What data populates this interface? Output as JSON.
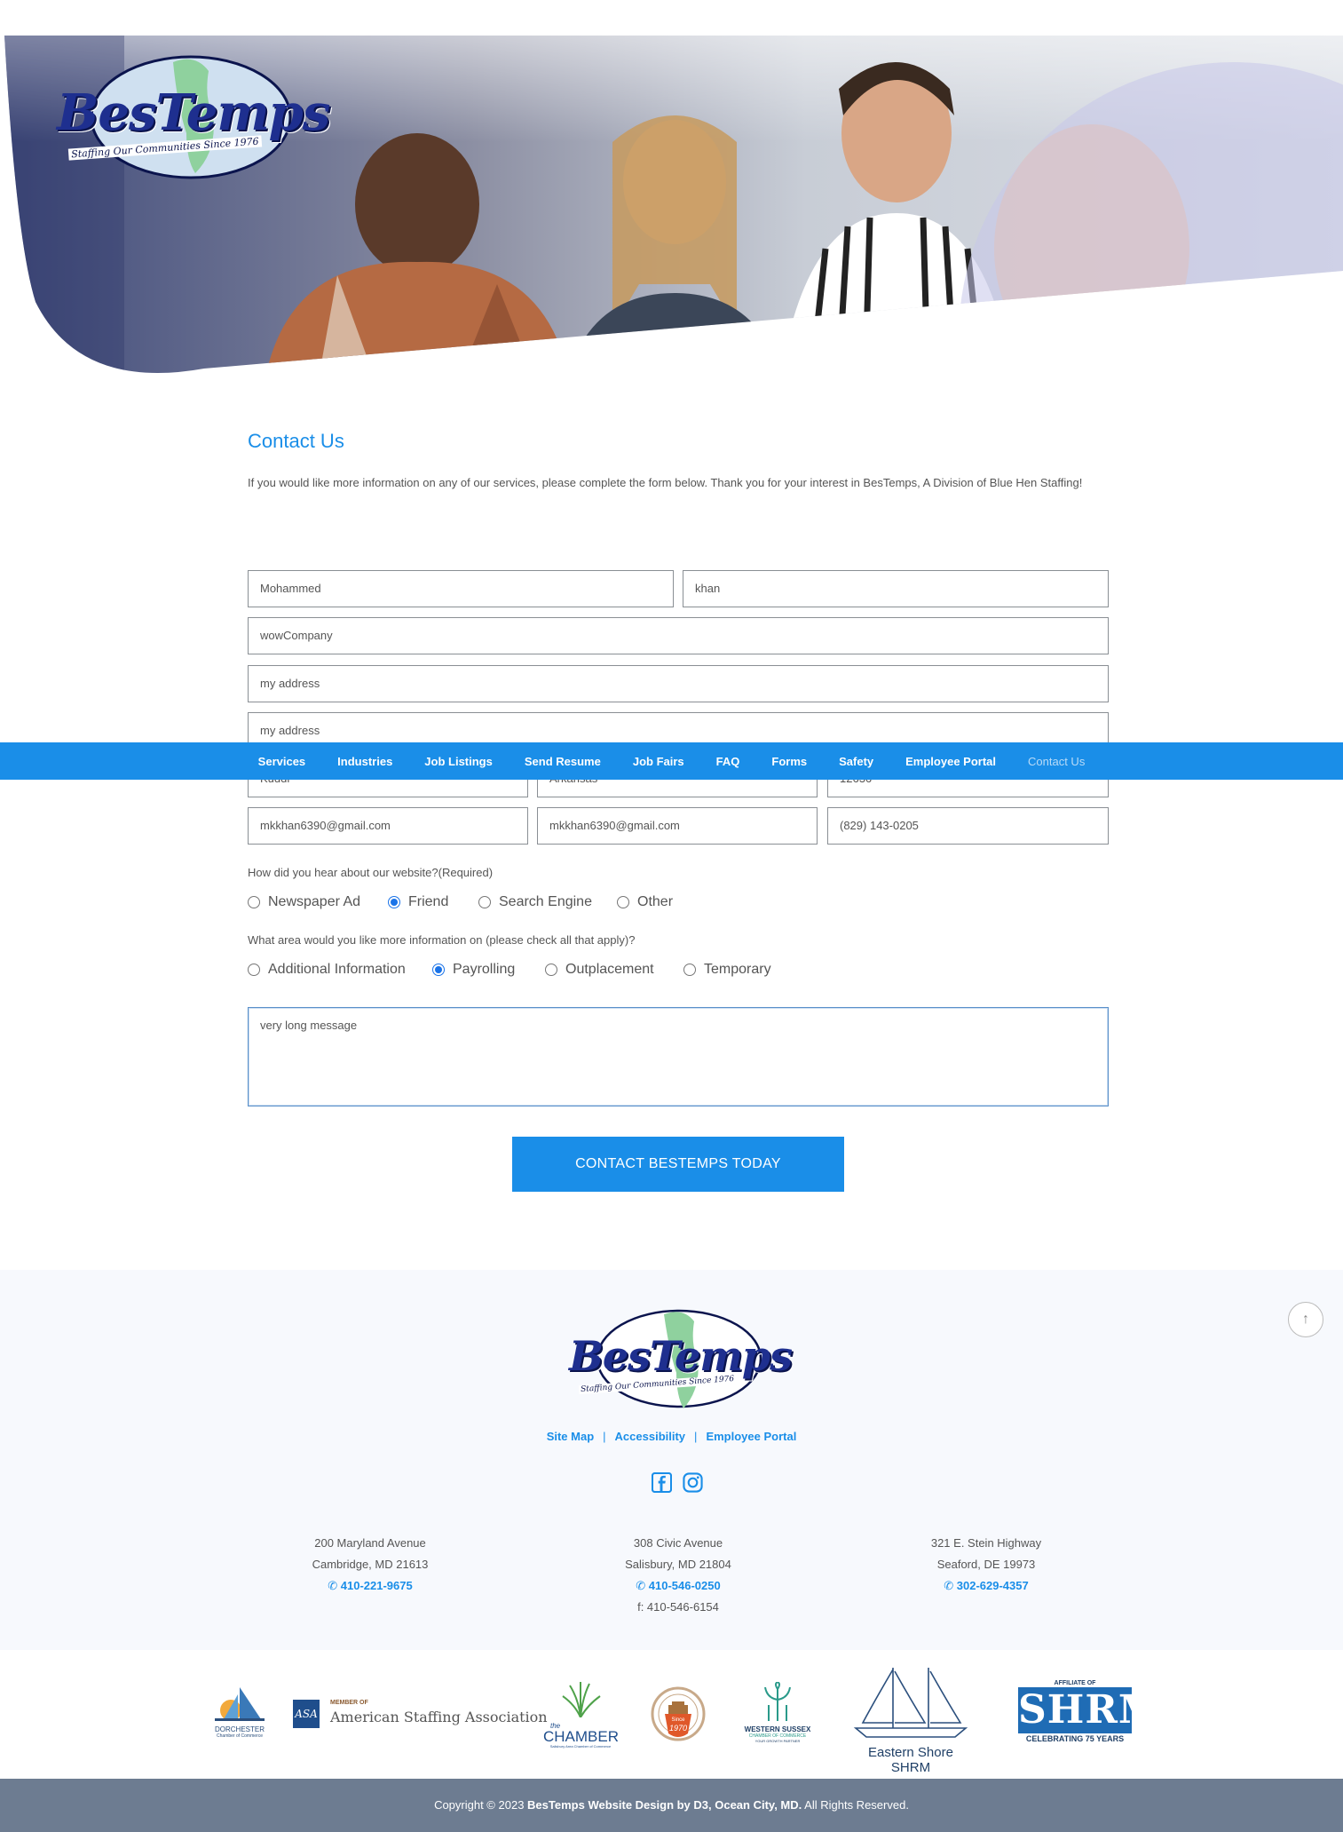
{
  "brand": {
    "logo_text": "BesTemps",
    "tagline": "Staffing Our Communities Since 1976"
  },
  "colors": {
    "accent": "#1a8ee8",
    "footer_bg": "#f7f9fd",
    "copyright_bg": "#6d7c91"
  },
  "nav": {
    "items": [
      {
        "label": "Services"
      },
      {
        "label": "Industries"
      },
      {
        "label": "Job Listings"
      },
      {
        "label": "Send Resume"
      },
      {
        "label": "Job Fairs"
      },
      {
        "label": "FAQ"
      },
      {
        "label": "Forms"
      },
      {
        "label": "Safety"
      },
      {
        "label": "Employee Portal"
      },
      {
        "label": "Contact Us",
        "active": true
      }
    ]
  },
  "contact": {
    "title": "Contact Us",
    "intro": "If you would like more information on any of our services, please complete the form below. Thank you for your interest in BesTemps, A Division of Blue Hen Staffing!",
    "fields": {
      "first_name": "Mohammed",
      "last_name": "khan",
      "company": "wowCompany",
      "address1": "my address",
      "address2": "my address",
      "city": "Kuddr",
      "state": "Arkansas",
      "zip": "12636",
      "email": "mkkhan6390@gmail.com",
      "email_confirm": "mkkhan6390@gmail.com",
      "phone": "(829) 143-0205",
      "message": "very long message"
    },
    "q1": {
      "label": "How did you hear about our website?(Required)",
      "options": [
        "Newspaper Ad",
        "Friend",
        "Search Engine",
        "Other"
      ],
      "selected": "Friend"
    },
    "q2": {
      "label": "What area would you like more information on (please check all that apply)?",
      "options": [
        "Additional Information",
        "Payrolling",
        "Outplacement",
        "Temporary"
      ],
      "selected": "Payrolling"
    },
    "submit_label": "CONTACT BESTEMPS TODAY"
  },
  "footer": {
    "links": [
      "Site Map",
      "Accessibility",
      "Employee Portal"
    ],
    "separator": "|",
    "social": [
      "facebook-icon",
      "instagram-icon"
    ],
    "locations": [
      {
        "street": "200 Maryland Avenue",
        "city": "Cambridge, MD 21613",
        "phone": "410-221-9675"
      },
      {
        "street": "308 Civic Avenue",
        "city": "Salisbury, MD 21804",
        "phone": "410-546-0250",
        "fax": "f: 410-546-6154"
      },
      {
        "street": "321 E. Stein Highway",
        "city": "Seaford, DE 19973",
        "phone": "302-629-4357"
      }
    ]
  },
  "partners": {
    "dorchester": {
      "name": "DORCHESTER",
      "sub": "Chamber of Commerce"
    },
    "asa": {
      "badge": "ASA",
      "member": "MEMBER OF",
      "name": "American Staffing Association"
    },
    "chamber": {
      "pre": "the",
      "name": "CHAMBER",
      "sub": "Salisbury Area Chamber of Commerce"
    },
    "salisbury_seal": {
      "since": "Since",
      "year": "1970"
    },
    "western_sussex": {
      "name": "WESTERN SUSSEX",
      "sub": "CHAMBER OF COMMERCE",
      "tag": "YOUR GROWTH PARTNER"
    },
    "eastern_shore": {
      "name": "Eastern Shore SHRM"
    },
    "shrm": {
      "top": "AFFILIATE OF",
      "name": "SHRM",
      "sub": "CELEBRATING 75 YEARS"
    }
  },
  "copyright": {
    "prefix": "Copyright © 2023",
    "bold": "BesTemps Website Design by D3, Ocean City, MD.",
    "suffix": "All Rights Reserved."
  }
}
